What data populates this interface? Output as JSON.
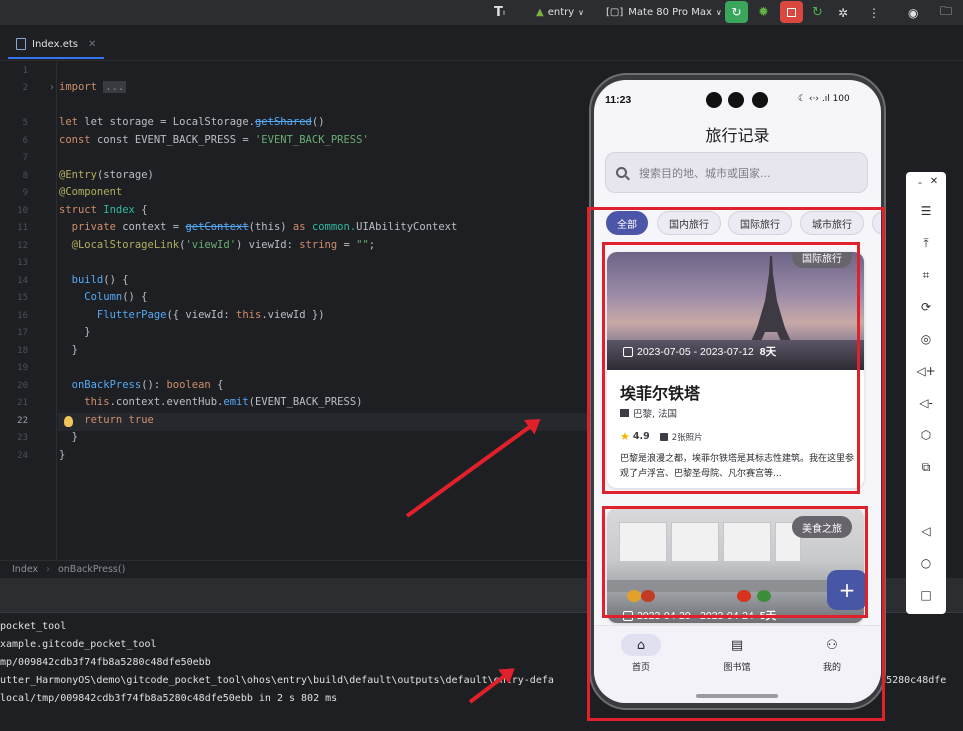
{
  "toolbar": {
    "module": "entry",
    "device": "Mate 80 Pro Max"
  },
  "tabs": [
    {
      "label": "Index.ets"
    }
  ],
  "editor": {
    "line_numbers": [
      "1",
      "2",
      "5",
      "6",
      "7",
      "8",
      "9",
      "10",
      "11",
      "12",
      "13",
      "14",
      "15",
      "16",
      "17",
      "18",
      "19",
      "20",
      "21",
      "22",
      "23",
      "24"
    ],
    "code": {
      "l2_import": "import",
      "l2_fold": "...",
      "l5": [
        "let storage = LocalStorage.",
        "getShared",
        "()"
      ],
      "l6": [
        "const EVENT_BACK_PRESS = ",
        "'EVENT_BACK_PRESS'"
      ],
      "l8": [
        "@Entry",
        "(storage)"
      ],
      "l9": "@Component",
      "l10": [
        "struct ",
        "Index",
        " {"
      ],
      "l11": [
        "  private ",
        "context = ",
        "getContext",
        "(this) ",
        "as ",
        "common.",
        "UIAbilityContext"
      ],
      "l12": [
        "  @LocalStorageLink",
        "(",
        "'viewId'",
        ") viewId: ",
        "string",
        " = ",
        "\"\"",
        ";"
      ],
      "l14": [
        "  build",
        "() {"
      ],
      "l15": [
        "    Column",
        "() {"
      ],
      "l16": [
        "      FlutterPage",
        "({ viewId: ",
        "this",
        ".viewId })"
      ],
      "l17": "    }",
      "l18": "  }",
      "l20": [
        "  onBackPress",
        "(): ",
        "boolean",
        " {"
      ],
      "l21": [
        "    this",
        ".context.eventHub.",
        "emit",
        "(EVENT_BACK_PRESS)"
      ],
      "l22": [
        "    return ",
        "true"
      ],
      "l23": "  }",
      "l24": "}"
    }
  },
  "breadcrumb": [
    "Index",
    "onBackPress()"
  ],
  "console": [
    "pocket_tool",
    "xample.gitcode_pocket_tool",
    "mp/009842cdb3f74fb8a5280c48dfe50ebb",
    "utter_HarmonyOS\\demo\\gitcode_pocket_tool\\ohos\\entry\\build\\default\\outputs\\default\\entry-defa",
    "local/tmp/009842cdb3f74fb8a5280c48dfe50ebb in 2 s 802 ms"
  ],
  "console_tail": "4fb8a5280c48dfe",
  "phone": {
    "status_time": "11:23",
    "status_icons": "☾ ‹·› .ıl 100",
    "app_title": "旅行记录",
    "search_placeholder": "搜索目的地、城市或国家...",
    "chips": [
      "全部",
      "国内旅行",
      "国际旅行",
      "城市旅行"
    ],
    "active_chip": "全部",
    "cards": [
      {
        "badge": "国际旅行",
        "date_range": "2023-07-05 - 2023-07-12",
        "days": "8天",
        "title": "埃菲尔铁塔",
        "location": "巴黎, 法国",
        "rating": "4.9",
        "photos": "2张照片",
        "description": "巴黎是浪漫之都，埃菲尔铁塔是其标志性建筑。我在这里参观了卢浮宫、巴黎圣母院、凡尔赛宫等..."
      },
      {
        "badge": "美食之旅",
        "date_range": "2023-04-20 - 2023-04-24",
        "days": "5天"
      }
    ],
    "fab": "+",
    "nav": [
      {
        "label": "首页",
        "icon": "home-icon"
      },
      {
        "label": "图书馆",
        "icon": "library-icon"
      },
      {
        "label": "我的",
        "icon": "person-icon"
      }
    ]
  },
  "colors": {
    "accent": "#4b56a8",
    "annotation_red": "#e0202a",
    "run_green": "#3aa65b",
    "stop_red": "#d9473f"
  }
}
